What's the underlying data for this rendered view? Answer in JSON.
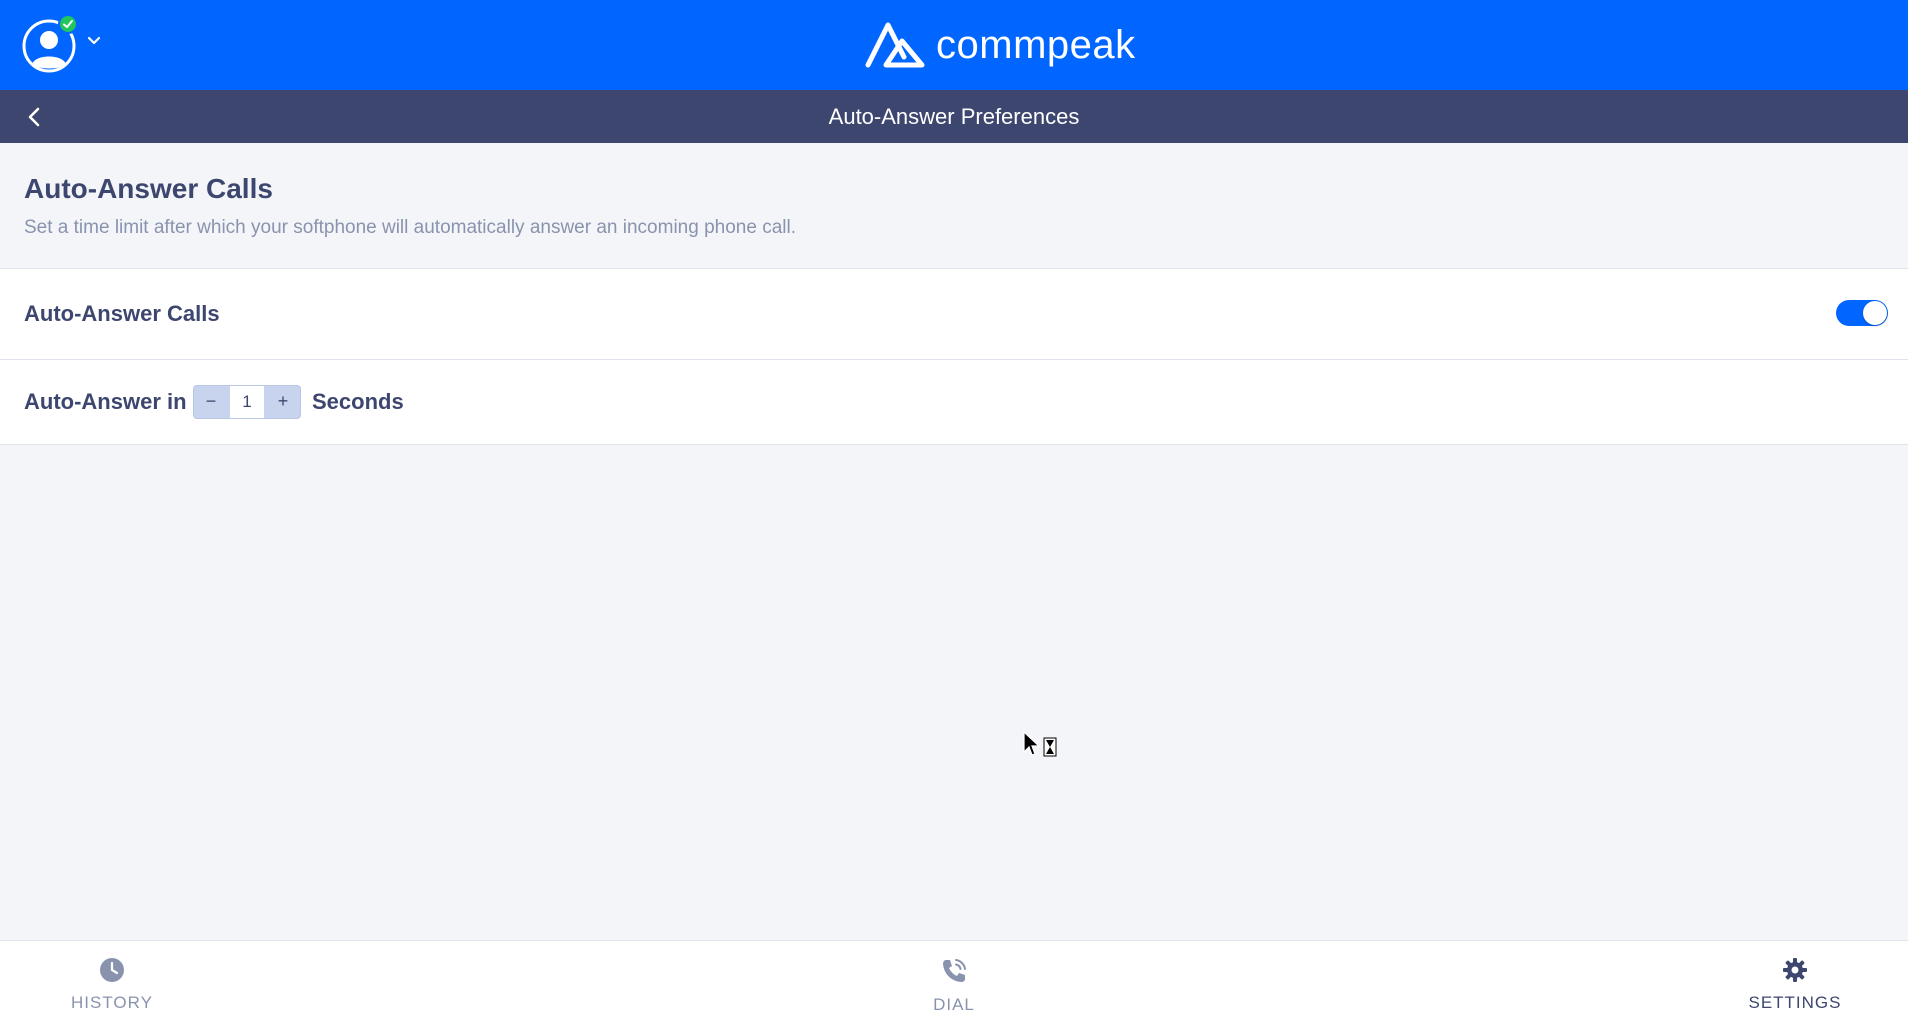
{
  "header": {
    "brand_name": "commpeak",
    "profile_status": "online",
    "status_color": "#22c55e",
    "bar_color": "#0066ff"
  },
  "subheader": {
    "title": "Auto-Answer Preferences",
    "back_icon": "chevron-left-icon"
  },
  "section": {
    "title": "Auto-Answer Calls",
    "description": "Set a time limit after which your softphone will automatically answer an incoming phone call."
  },
  "auto_answer_toggle": {
    "label": "Auto-Answer Calls",
    "enabled": true
  },
  "auto_answer_delay": {
    "label": "Auto-Answer in",
    "value": "1",
    "minus_label": "−",
    "plus_label": "+",
    "unit": "Seconds"
  },
  "bottom_nav": {
    "items": [
      {
        "label": "HISTORY",
        "icon": "clock-icon",
        "active": false
      },
      {
        "label": "DIAL",
        "icon": "phone-icon",
        "active": false
      },
      {
        "label": "SETTINGS",
        "icon": "gear-icon",
        "active": true
      }
    ]
  }
}
